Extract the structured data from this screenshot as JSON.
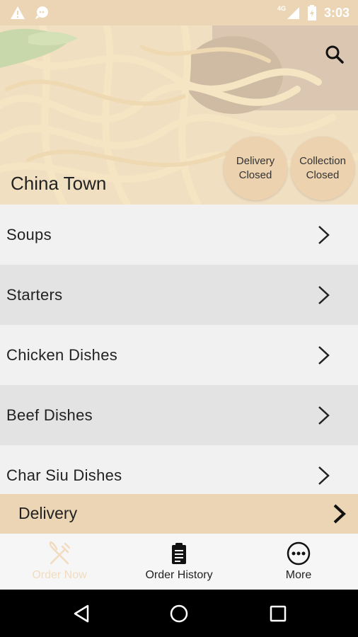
{
  "status_bar": {
    "time": "3:03",
    "network": "4G",
    "icons": [
      "warning-icon",
      "chat-bubble-icon",
      "signal-icon",
      "battery-icon"
    ]
  },
  "header": {
    "restaurant_name": "China Town",
    "delivery_status": "Delivery Closed",
    "collection_status": "Collection Closed",
    "search_icon": "search-icon"
  },
  "menu": {
    "categories": [
      {
        "label": "Soups"
      },
      {
        "label": "Starters"
      },
      {
        "label": "Chicken Dishes"
      },
      {
        "label": "Beef Dishes"
      },
      {
        "label": "Char Siu Dishes"
      }
    ]
  },
  "order_mode": {
    "label": "Delivery"
  },
  "bottom_nav": {
    "items": [
      {
        "label": "Order Now",
        "icon": "fork-knife-icon",
        "active": true
      },
      {
        "label": "Order History",
        "icon": "clipboard-icon"
      },
      {
        "label": "More",
        "icon": "more-dots-icon"
      }
    ]
  },
  "colors": {
    "accent": "#ecd5b4",
    "badge": "#ecd2af",
    "row_light": "#f1f1f1",
    "row_dark": "#e3e3e3",
    "text": "#222222"
  }
}
